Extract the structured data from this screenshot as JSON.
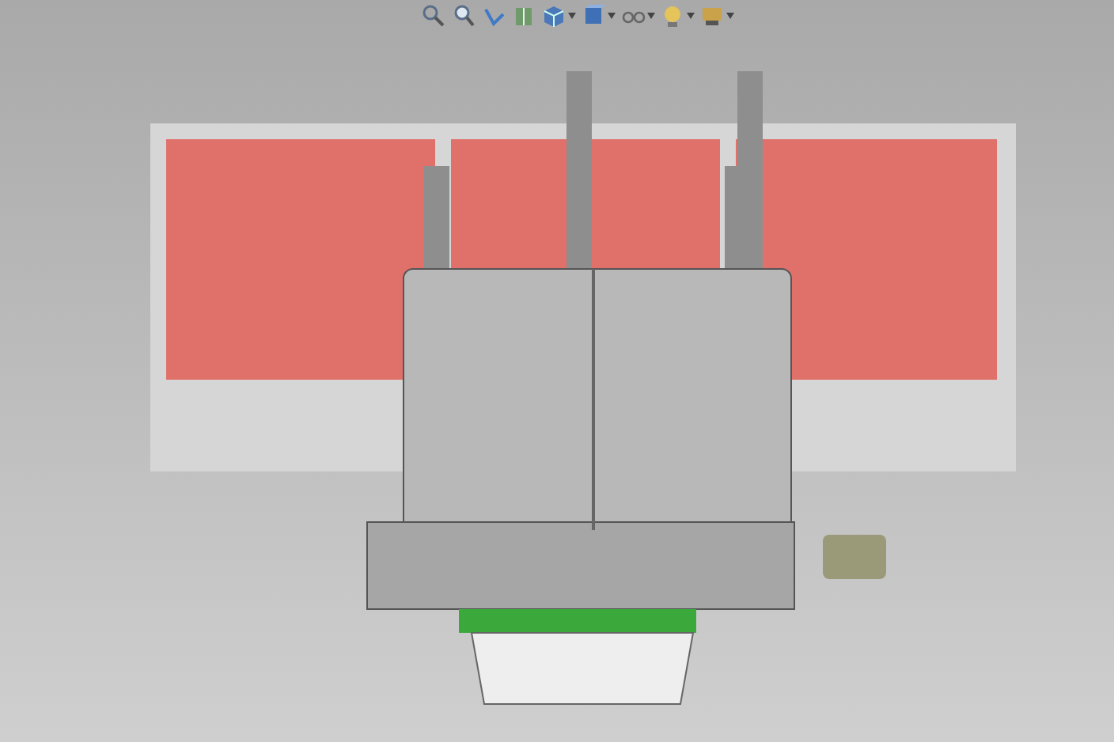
{
  "toolbar": [
    {
      "kind": "zoom-fit",
      "dropdown": false
    },
    {
      "kind": "zoom-area",
      "dropdown": false
    },
    {
      "kind": "previous-view",
      "dropdown": false
    },
    {
      "kind": "section-view",
      "dropdown": false
    },
    {
      "kind": "view-orientation",
      "dropdown": true
    },
    {
      "kind": "display-style",
      "dropdown": true
    },
    {
      "kind": "hide-show",
      "dropdown": true
    },
    {
      "kind": "scene",
      "dropdown": true
    },
    {
      "kind": "view-settings",
      "dropdown": true
    }
  ]
}
